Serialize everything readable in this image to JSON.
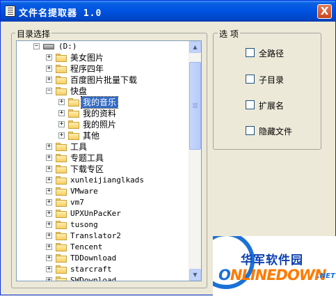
{
  "window": {
    "title": "文件名提取器 1.0",
    "close": "X"
  },
  "dir_group": {
    "label": "目录选择"
  },
  "options_group": {
    "label": "选 项"
  },
  "tree": {
    "drive": "(D:)",
    "nodes": [
      "美女图片",
      "程序四年",
      "百度图片批量下载",
      "快盘",
      "我的音乐",
      "我的资料",
      "我的照片",
      "其他",
      "工具",
      "专题工具",
      "下载专区",
      "xunleijianglkads",
      "VMware",
      "vm7",
      "UPXUnPacKer",
      "tusong",
      "Translator2",
      "Tencent",
      "TDDownload",
      "starcraft",
      "SWDownload"
    ],
    "selected": "我的音乐"
  },
  "scrollbar": {
    "up": "▲",
    "down": "▼"
  },
  "options": [
    {
      "label": "全路径",
      "checked": false
    },
    {
      "label": "子目录",
      "checked": false
    },
    {
      "label": "扩展名",
      "checked": false
    },
    {
      "label": "隐藏文件",
      "checked": false
    }
  ],
  "watermark": {
    "cn": "华军软件园",
    "en_o": "O",
    "en_rest": "NLINEDOWN",
    "net": ".NET"
  }
}
